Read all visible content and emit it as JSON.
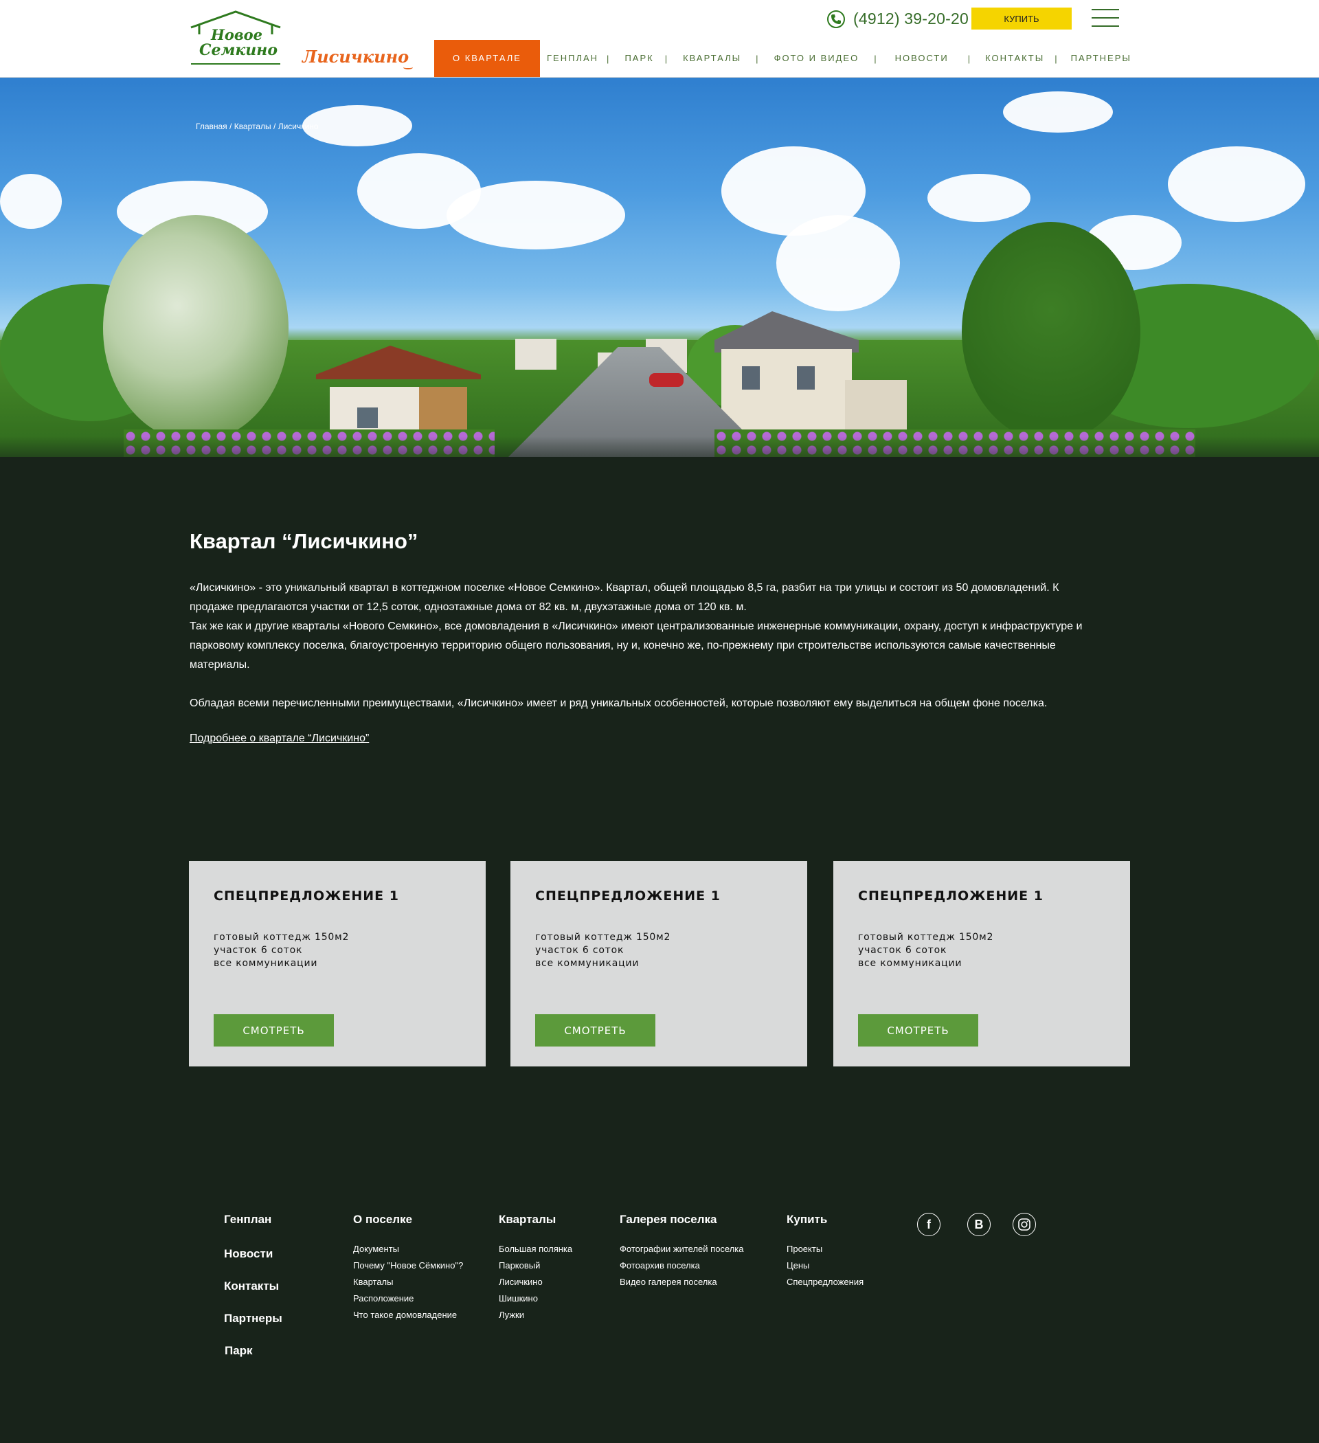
{
  "header": {
    "logo_line1": "Новое",
    "logo_line2": "Семкино",
    "sub_logo": "Лисичкино",
    "phone": "(4912) 39-20-20",
    "buy_label": "КУПИТЬ",
    "nav": [
      {
        "label": "О КВАРТАЛЕ",
        "active": true
      },
      {
        "label": "ГЕНПЛАН"
      },
      {
        "label": "ПАРК"
      },
      {
        "label": "КВАРТАЛЫ"
      },
      {
        "label": "ФОТО И ВИДЕО"
      },
      {
        "label": "НОВОСТИ"
      },
      {
        "label": "КОНТАКТЫ"
      },
      {
        "label": "ПАРТНЕРЫ"
      }
    ],
    "nav_separator": "|"
  },
  "breadcrumb": {
    "items": [
      "Главная",
      "Кварталы",
      "Лисичкино"
    ],
    "separator": " / "
  },
  "content": {
    "title": "Квартал “Лисичкино”",
    "p1": "«Лисичкино» - это уникальный квартал в коттеджном поселке «Новое Семкино». Квартал, общей площадью 8,5 га, разбит на три улицы и состоит из 50 домовладений. К продаже предлагаются участки от 12,5 соток, одноэтажные дома от 82 кв. м, двухэтажные дома от 120 кв. м.",
    "p2": "Так же как и другие кварталы «Нового Семкино», все домовладения в «Лисичкино» имеют централизованные инженерные коммуникации, охрану, доступ к инфраструктуре и парковому комплексу поселка, благоустроенную территорию общего пользования, ну и, конечно же, по-прежнему при строительстве используются самые качественные материалы.",
    "p3": "Обладая всеми перечисленными преимуществами, «Лисичкино» имеет и ряд уникальных особенностей, которые позволяют ему выделиться на общем фоне поселка.",
    "more_link": "Подробнее о квартале “Лисичкино”"
  },
  "offers": [
    {
      "title": "СПЕЦПРЕДЛОЖЕНИЕ 1",
      "line1": "готовый коттедж 150м2",
      "line2": "участок 6 соток",
      "line3": "все коммуникации",
      "button": "СМОТРЕТЬ"
    },
    {
      "title": "СПЕЦПРЕДЛОЖЕНИЕ 1",
      "line1": "готовый коттедж 150м2",
      "line2": "участок 6 соток",
      "line3": "все коммуникации",
      "button": "СМОТРЕТЬ"
    },
    {
      "title": "СПЕЦПРЕДЛОЖЕНИЕ 1",
      "line1": "готовый коттедж 150м2",
      "line2": "участок 6 соток",
      "line3": "все коммуникации",
      "button": "СМОТРЕТЬ"
    }
  ],
  "footer": {
    "main_links": [
      "Генплан",
      "Новости",
      "Контакты",
      "Партнеры",
      "Парк"
    ],
    "columns": [
      {
        "title": "О поселке",
        "items": [
          "Документы",
          "Почему \"Новое Сёмкино\"?",
          "Кварталы",
          "Расположение",
          "Что такое домовладение"
        ]
      },
      {
        "title": "Кварталы",
        "items": [
          "Большая полянка",
          "Парковый",
          "Лисичкино",
          "Шишкино",
          "Лужки"
        ]
      },
      {
        "title": "Галерея поселка",
        "items": [
          "Фотографии жителей поселка",
          "Фотоархив поселка",
          "Видео галерея поселка"
        ]
      },
      {
        "title": "Купить",
        "items": [
          "Проекты",
          "Цены",
          "Спецпредложения"
        ]
      }
    ],
    "social": [
      {
        "icon": "facebook-icon",
        "glyph": "f"
      },
      {
        "icon": "vk-icon",
        "glyph": "B"
      },
      {
        "icon": "instagram-icon",
        "glyph": ""
      }
    ]
  },
  "colors": {
    "background": "#18231a",
    "accent_orange": "#ea5c0b",
    "buy_yellow": "#f5d400",
    "brand_green": "#2e7a1e",
    "button_green": "#5c9a3b",
    "card_bg": "#d9dada"
  }
}
